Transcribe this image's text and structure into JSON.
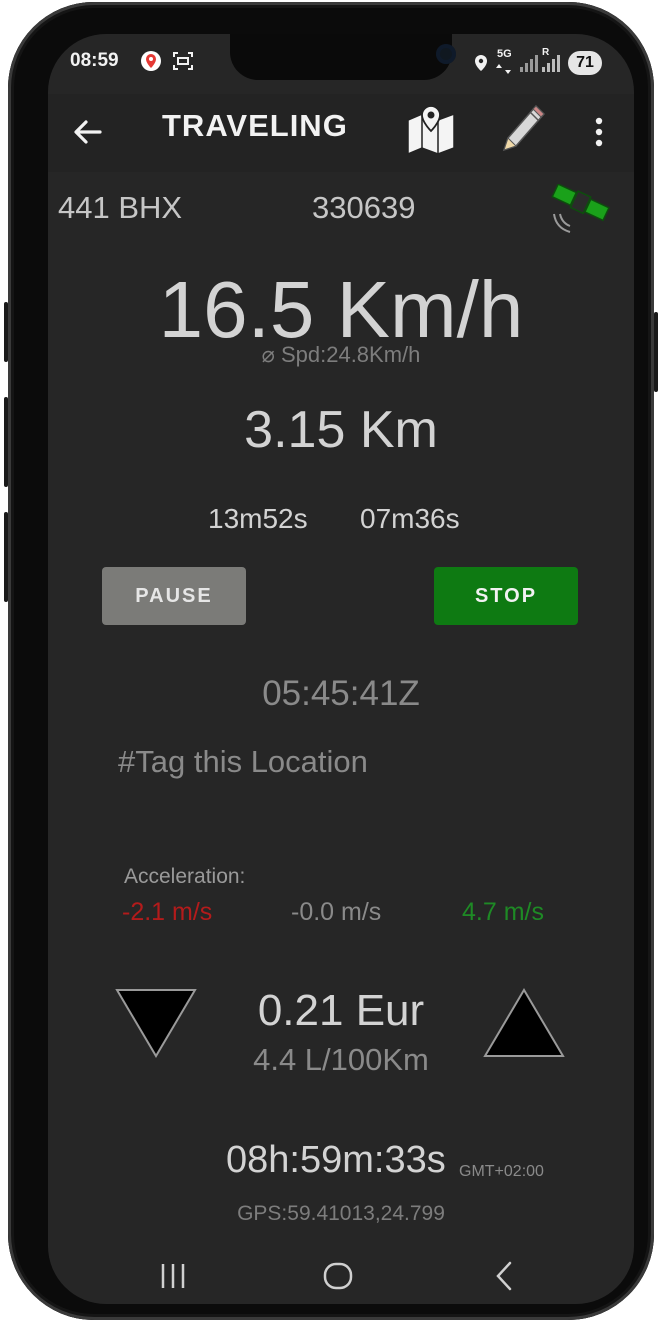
{
  "status_bar": {
    "time": "08:59",
    "network": "5G",
    "roaming": "R",
    "battery": "71"
  },
  "app_bar": {
    "title": "TRAVELING",
    "back_icon": "arrow-left-icon",
    "map_icon": "map-pin-icon",
    "edit_icon": "pencil-icon",
    "more_icon": "more-vertical-icon"
  },
  "info_row": {
    "plate": "441 BHX",
    "odometer": "330639",
    "gps_icon": "satellite-icon"
  },
  "speed": {
    "current": "16.5 Km/h",
    "average": "⌀ Spd:24.8Km/h"
  },
  "distance": "3.15 Km",
  "times": {
    "moving": "13m52s",
    "stopped": "07m36s"
  },
  "buttons": {
    "pause": "PAUSE",
    "stop": "STOP"
  },
  "utc_time": "05:45:41Z",
  "tag_location": "#Tag this Location",
  "acceleration": {
    "label": "Acceleration:",
    "min": "-2.1 m/s",
    "current": "-0.0 m/s",
    "max": "4.7 m/s"
  },
  "cost": {
    "amount": "0.21 Eur",
    "consumption": "4.4 L/100Km"
  },
  "clock": {
    "time": "08h:59m:33s",
    "timezone": "GMT+02:00"
  },
  "gps": "GPS:59.41013,24.799",
  "colors": {
    "background": "#262626",
    "pause_button": "#7b7b78",
    "stop_button": "#0e7a12",
    "accel_negative": "#b31b1b",
    "accel_positive": "#1e8a25"
  }
}
